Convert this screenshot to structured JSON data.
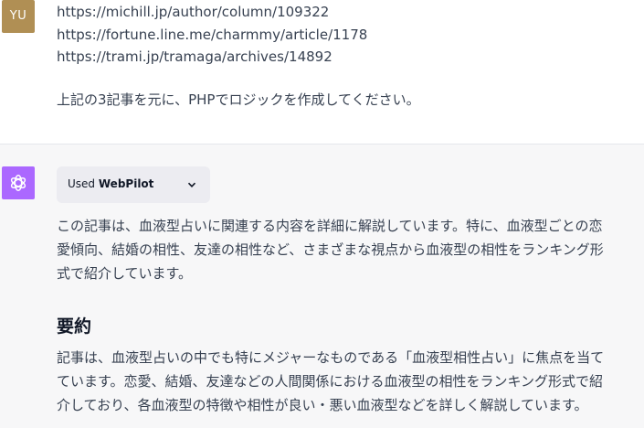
{
  "user_message": {
    "avatar_initials": "YU",
    "urls": [
      "https://michill.jp/author/column/109322",
      "https://fortune.line.me/charmmy/article/1178",
      "https://trami.jp/tramaga/archives/14892"
    ],
    "instruction": "上記の3記事を元に、PHPでロジックを作成してください。"
  },
  "assistant_message": {
    "avatar_icon": "openai-logo-icon",
    "plugin": {
      "prefix": "Used",
      "name": "WebPilot",
      "toggle_icon": "chevron-down-icon"
    },
    "intro_lines": [
      "この記事は、血液型占いに関連する内容を詳細に解説しています。特に、血液型ごとの恋",
      "愛傾向、結婚の相性、友達の相性など、さまざまな視点から血液型の相性をランキング形",
      "式で紹介しています。"
    ],
    "summary_heading": "要約",
    "summary_lines": [
      "記事は、血液型占いの中でも特にメジャーなものである「血液型相性占い」に焦点を当て",
      "ています。恋愛、結婚、友達などの人間関係における血液型の相性をランキング形式で紹",
      "介しており、各血液型の特徴や相性が良い・悪い血液型などを詳しく解説しています。"
    ]
  },
  "colors": {
    "user_avatar_bg": "#b08f54",
    "assistant_avatar_bg": "#ab68ff",
    "assistant_bg": "#f7f7f8",
    "pill_bg": "#ececf1",
    "text": "#374151"
  }
}
